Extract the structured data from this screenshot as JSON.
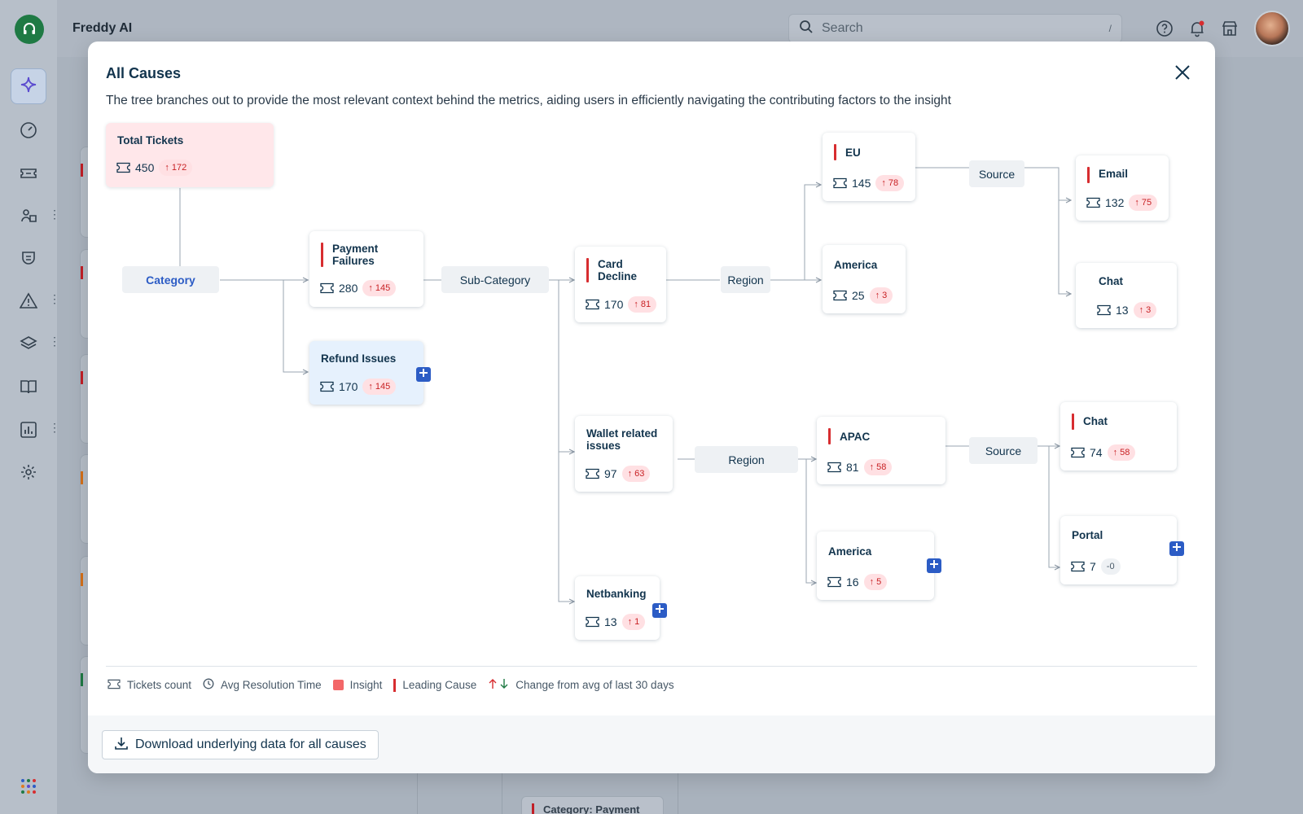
{
  "app": {
    "title": "Freddy AI"
  },
  "search": {
    "placeholder": "Search",
    "shortcut": "/"
  },
  "background": {
    "bottom_card_label": "Category: Payment"
  },
  "modal": {
    "title": "All Causes",
    "description": "The tree branches out to provide the most relevant context behind the metrics, aiding users in efficiently navigating the contributing factors to the insight",
    "download_label": "Download underlying data for all causes"
  },
  "dimensions": {
    "category": "Category",
    "sub_category": "Sub-Category",
    "region_card": "Region",
    "region_wallet": "Region",
    "source_eu": "Source",
    "source_apac": "Source"
  },
  "nodes": {
    "total": {
      "label": "Total Tickets",
      "count": "450",
      "change": "172"
    },
    "payment_failures": {
      "label": "Payment Failures",
      "count": "280",
      "change": "145"
    },
    "refund_issues": {
      "label": "Refund Issues",
      "count": "170",
      "change": "145"
    },
    "card_decline": {
      "label": "Card Decline",
      "count": "170",
      "change": "81"
    },
    "wallet": {
      "label": "Wallet related issues",
      "count": "97",
      "change": "63"
    },
    "netbanking": {
      "label": "Netbanking",
      "count": "13",
      "change": "1"
    },
    "eu": {
      "label": "EU",
      "count": "145",
      "change": "78"
    },
    "america_card": {
      "label": "America",
      "count": "25",
      "change": "3"
    },
    "apac": {
      "label": "APAC",
      "count": "81",
      "change": "58"
    },
    "america_wallet": {
      "label": "America",
      "count": "16",
      "change": "5"
    },
    "email": {
      "label": "Email",
      "count": "132",
      "change": "75"
    },
    "chat_eu": {
      "label": "Chat",
      "count": "13",
      "change": "3"
    },
    "chat_apac": {
      "label": "Chat",
      "count": "74",
      "change": "58"
    },
    "portal": {
      "label": "Portal",
      "count": "7",
      "change": "-0"
    }
  },
  "legend": {
    "tickets": "Tickets count",
    "avg_time": "Avg Resolution Time",
    "insight": "Insight",
    "leading": "Leading Cause",
    "change": "Change from avg of last 30 days"
  },
  "colors": {
    "insight": "#f36768",
    "leading_cause": "#d72d30",
    "accent": "#2c5cc5",
    "increase": "#c82124",
    "decrease": "#1f7a44"
  }
}
